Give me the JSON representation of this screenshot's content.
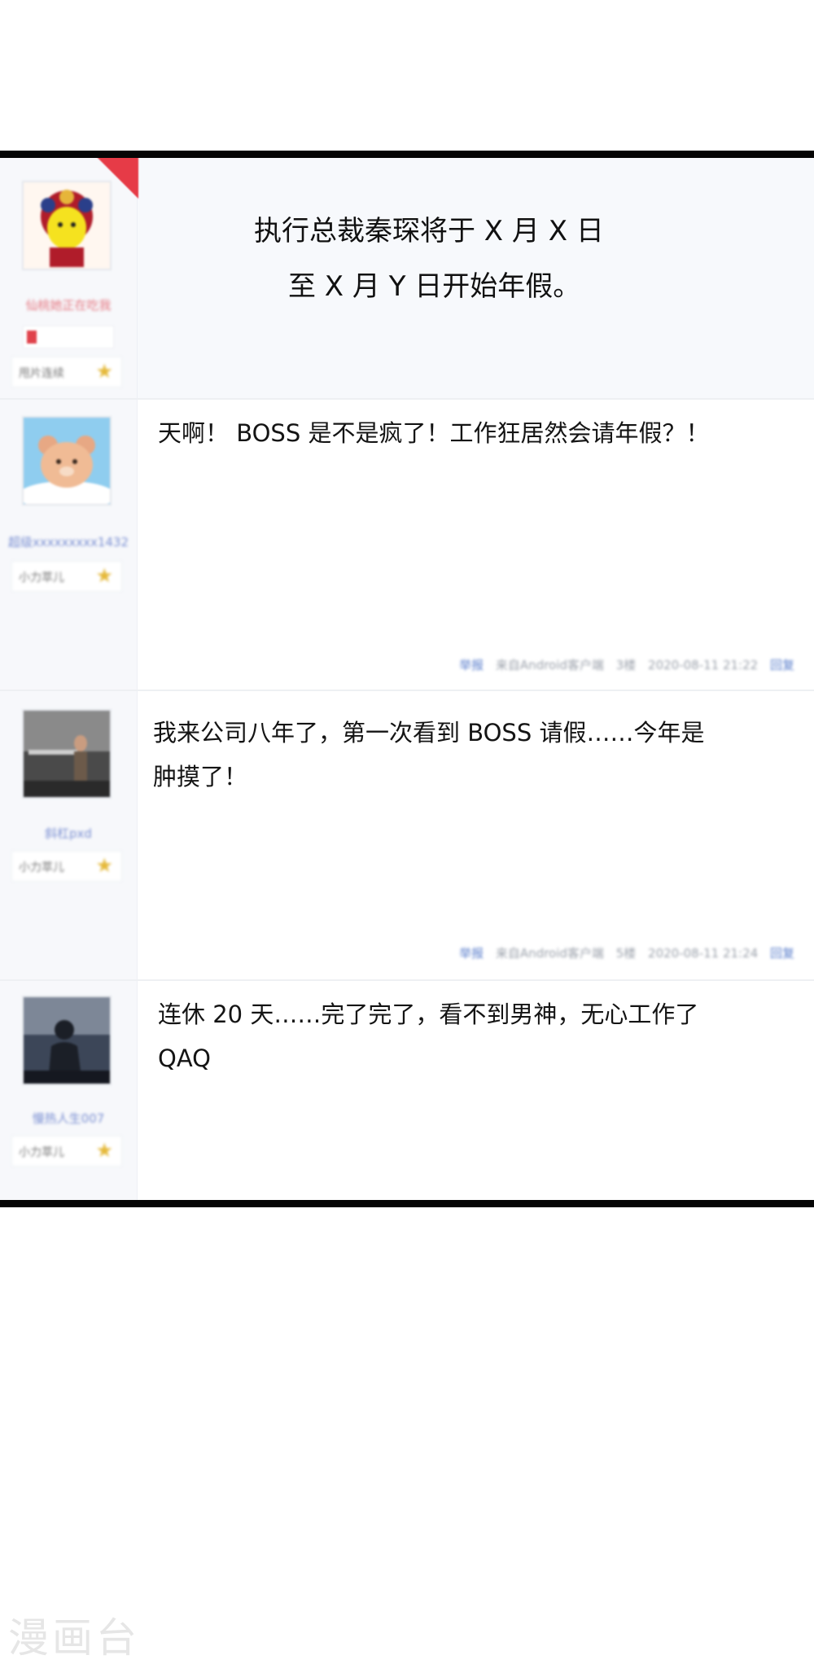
{
  "posts": [
    {
      "user": "仙桃她正在吃我",
      "rank": "甩片连续",
      "content_lines": [
        "执行总裁秦琛将于 X 月 X 日",
        "至 X 月 Y 日开始年假。"
      ]
    },
    {
      "user": "超级xxxxxxxxx1432",
      "rank": "小力萃儿",
      "content_lines": [
        "天啊！ BOSS 是不是疯了！工作狂居然会请年假？！"
      ],
      "footer": {
        "report": "举报",
        "client": "来自Android客户端",
        "floor": "3楼",
        "time": "2020-08-11 21:22",
        "reply": "回复"
      }
    },
    {
      "user": "斜杠pxd",
      "rank": "小力萃儿",
      "content_lines": [
        "我来公司八年了，第一次看到 BOSS 请假……今年是",
        "肿摸了！"
      ],
      "footer": {
        "report": "举报",
        "client": "来自Android客户端",
        "floor": "5楼",
        "time": "2020-08-11 21:24",
        "reply": "回复"
      }
    },
    {
      "user": "慢热人生007",
      "rank": "小力萃儿",
      "content_lines": [
        "连休 20 天……完了完了，看不到男神，无心工作了",
        "QAQ"
      ]
    }
  ],
  "watermark": "漫画台",
  "colors": {
    "border": "#050505",
    "link": "#7a8fd2",
    "star": "#e5b93b",
    "ribbon": "#e63b47"
  }
}
